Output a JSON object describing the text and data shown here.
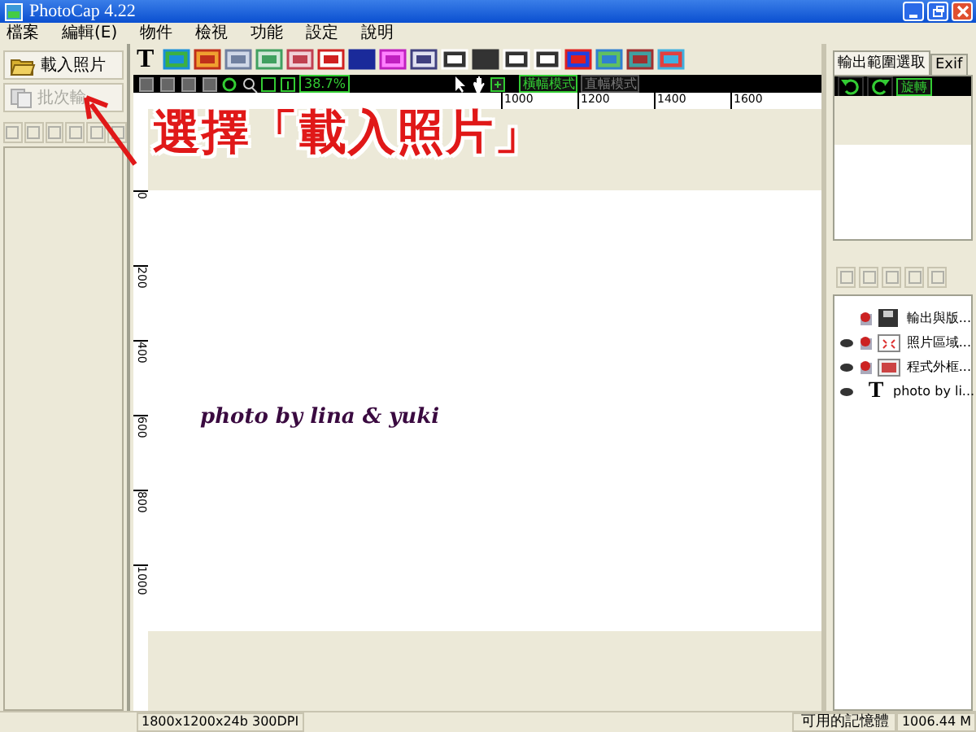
{
  "window": {
    "title": "PhotoCap 4.22"
  },
  "menu": [
    "檔案",
    "編輯(E)",
    "物件",
    "檢視",
    "功能",
    "設定",
    "說明"
  ],
  "left_panel": {
    "buttons": [
      {
        "label": "載入照片",
        "disabled": false
      },
      {
        "label": "批次輸",
        "disabled": true
      }
    ]
  },
  "toolbar": {
    "text_tool": "T"
  },
  "view_bar": {
    "zoom": "38.7%",
    "modes": [
      {
        "label": "橫幅模式",
        "selected": true
      },
      {
        "label": "直幅模式",
        "selected": false
      }
    ]
  },
  "rulers": {
    "horizontal": [
      "1000",
      "1200",
      "1400",
      "1600"
    ],
    "vertical": [
      "0",
      "200",
      "400",
      "600",
      "800",
      "1000"
    ]
  },
  "canvas": {
    "caption": "photo by lina & yuki"
  },
  "right_panel": {
    "tabs": [
      {
        "label": "輸出範圍選取",
        "selected": true
      },
      {
        "label": "Exif",
        "selected": false
      }
    ],
    "rotate_button": "旋轉",
    "layers": [
      {
        "kind": "output",
        "name": "輸出與版...",
        "visible": false
      },
      {
        "kind": "photo",
        "name": "照片區域...",
        "visible": true
      },
      {
        "kind": "frame",
        "name": "程式外框...",
        "visible": true
      },
      {
        "kind": "text",
        "glyph": "T",
        "name": "photo by li...",
        "visible": true
      }
    ]
  },
  "status_bar": {
    "image_info": "1800x1200x24b  300DPI",
    "memory_label": "可用的記憶體",
    "memory_value": "1006.44 M"
  },
  "annotation": {
    "text": "選擇「載入照片」"
  }
}
